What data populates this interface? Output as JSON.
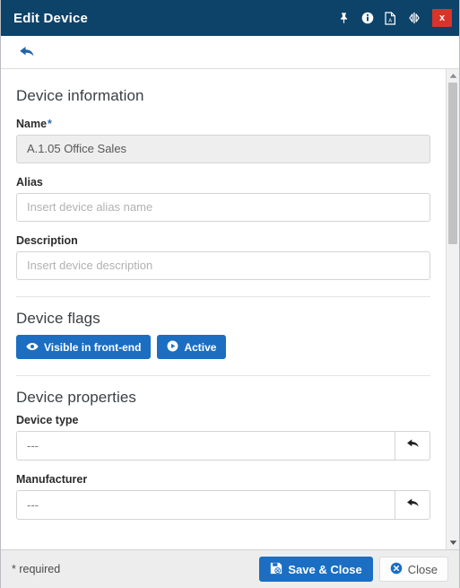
{
  "window": {
    "title": "Edit Device",
    "titlebar_icons": [
      {
        "name": "pin-icon",
        "label": "Pin"
      },
      {
        "name": "info-icon",
        "label": "Info"
      },
      {
        "name": "pdf-file-icon",
        "label": "Export PDF"
      },
      {
        "name": "resize-width-icon",
        "label": "Resize"
      }
    ],
    "close_label": "x"
  },
  "toolbar": {
    "back_label": "Back"
  },
  "sections": {
    "device_information": {
      "heading": "Device information",
      "fields": {
        "name": {
          "label": "Name",
          "required_marker": "*",
          "value": "A.1.05 Office Sales"
        },
        "alias": {
          "label": "Alias",
          "value": "",
          "placeholder": "Insert device alias name"
        },
        "description": {
          "label": "Description",
          "value": "",
          "placeholder": "Insert device description"
        }
      }
    },
    "device_flags": {
      "heading": "Device flags",
      "buttons": [
        {
          "label": "Visible in front-end",
          "icon": "eye-icon",
          "active": true
        },
        {
          "label": "Active",
          "icon": "play-circle-icon",
          "active": true
        }
      ]
    },
    "device_properties": {
      "heading": "Device properties",
      "fields": {
        "device_type": {
          "label": "Device type",
          "value": "---",
          "reset_icon": "reset-arrow-icon"
        },
        "manufacturer": {
          "label": "Manufacturer",
          "value": "---",
          "reset_icon": "reset-arrow-icon"
        }
      }
    }
  },
  "footer": {
    "required_note": "* required",
    "save_label": "Save & Close",
    "close_label": "Close"
  },
  "colors": {
    "titlebar": "#0d4269",
    "accent_blue": "#1b6ec2",
    "close_red": "#d9342b",
    "footer_bg": "#ededed",
    "readonly_bg": "#eeeeee"
  }
}
